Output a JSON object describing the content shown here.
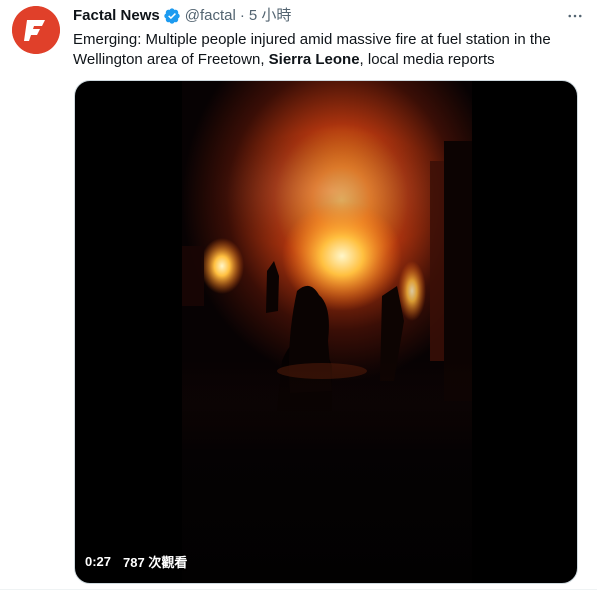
{
  "tweet": {
    "author_name": "Factal News",
    "handle": "@factal",
    "separator": "·",
    "timestamp": "5 小時",
    "text_before": "Emerging: Multiple people injured amid massive fire at fuel station in the Wellington area of Freetown, ",
    "text_bold": "Sierra Leone",
    "text_after": ", local media reports",
    "avatar_icon": "factal-logo-icon",
    "verified_icon": "verified-badge-icon",
    "more_icon": "more-options-icon",
    "avatar_color": "#e0402a",
    "verified_color": "#1d9bf0"
  },
  "video": {
    "duration": "0:27",
    "views": "787 次觀看"
  }
}
